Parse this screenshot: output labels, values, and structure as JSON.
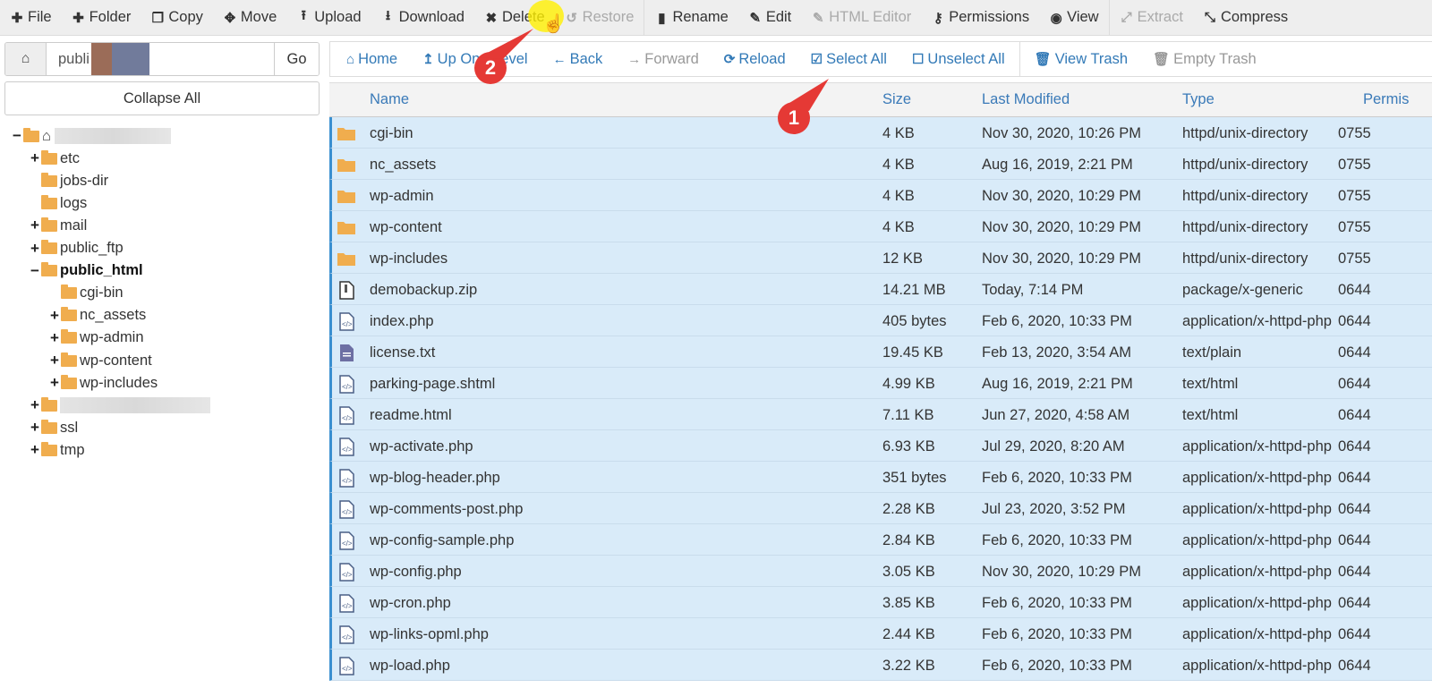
{
  "toolbar": {
    "items": [
      {
        "label": "File",
        "icon": "plus-icon",
        "glyph": "✚",
        "disabled": false
      },
      {
        "label": "Folder",
        "icon": "plus-icon",
        "glyph": "✚",
        "disabled": false
      },
      {
        "label": "Copy",
        "icon": "copy-icon",
        "glyph": "❐",
        "disabled": false
      },
      {
        "label": "Move",
        "icon": "move-icon",
        "glyph": "✥",
        "disabled": false
      },
      {
        "label": "Upload",
        "icon": "upload-icon",
        "glyph": "⭱",
        "disabled": false
      },
      {
        "label": "Download",
        "icon": "download-icon",
        "glyph": "⭳",
        "disabled": false
      },
      {
        "label": "Delete",
        "icon": "delete-icon",
        "glyph": "✖",
        "disabled": false
      },
      {
        "label": "Restore",
        "icon": "restore-icon",
        "glyph": "↺",
        "disabled": true
      },
      {
        "label": "Rename",
        "icon": "file-icon",
        "glyph": "▮",
        "disabled": false
      },
      {
        "label": "Edit",
        "icon": "pencil-icon",
        "glyph": "✎",
        "disabled": false
      },
      {
        "label": "HTML Editor",
        "icon": "edit-square-icon",
        "glyph": "✎",
        "disabled": true
      },
      {
        "label": "Permissions",
        "icon": "key-icon",
        "glyph": "⚷",
        "disabled": false
      },
      {
        "label": "View",
        "icon": "eye-icon",
        "glyph": "◉",
        "disabled": false
      },
      {
        "label": "Extract",
        "icon": "expand-icon",
        "glyph": "⤢",
        "disabled": true
      },
      {
        "label": "Compress",
        "icon": "compress-icon",
        "glyph": "⤡",
        "disabled": false
      }
    ]
  },
  "sidebar": {
    "path_value": "publi",
    "go_label": "Go",
    "collapse_label": "Collapse All",
    "tree": [
      {
        "label": "",
        "toggle": "−",
        "level": 0,
        "home": true,
        "redacted": true
      },
      {
        "label": "etc",
        "toggle": "+",
        "level": 1
      },
      {
        "label": "jobs-dir",
        "toggle": "",
        "level": 1
      },
      {
        "label": "logs",
        "toggle": "",
        "level": 1
      },
      {
        "label": "mail",
        "toggle": "+",
        "level": 1
      },
      {
        "label": "public_ftp",
        "toggle": "+",
        "level": 1
      },
      {
        "label": "public_html",
        "toggle": "−",
        "level": 1,
        "bold": true,
        "open": true
      },
      {
        "label": "cgi-bin",
        "toggle": "",
        "level": 2
      },
      {
        "label": "nc_assets",
        "toggle": "+",
        "level": 2
      },
      {
        "label": "wp-admin",
        "toggle": "+",
        "level": 2
      },
      {
        "label": "wp-content",
        "toggle": "+",
        "level": 2
      },
      {
        "label": "wp-includes",
        "toggle": "+",
        "level": 2
      },
      {
        "label": "",
        "toggle": "+",
        "level": 1,
        "redacted": true
      },
      {
        "label": "ssl",
        "toggle": "+",
        "level": 1
      },
      {
        "label": "tmp",
        "toggle": "+",
        "level": 1
      }
    ]
  },
  "navbar": {
    "items": [
      {
        "label": "Home",
        "icon": "home-icon",
        "glyph": "⌂",
        "disabled": false
      },
      {
        "label": "Up One Level",
        "icon": "level-up-icon",
        "glyph": "↥",
        "disabled": false
      },
      {
        "label": "Back",
        "icon": "arrow-left-icon",
        "glyph": "←",
        "disabled": false
      },
      {
        "label": "Forward",
        "icon": "arrow-right-icon",
        "glyph": "→",
        "disabled": true
      },
      {
        "label": "Reload",
        "icon": "reload-icon",
        "glyph": "⟳",
        "disabled": false
      },
      {
        "label": "Select All",
        "icon": "checkbox-checked-icon",
        "glyph": "☑",
        "disabled": false
      },
      {
        "label": "Unselect All",
        "icon": "checkbox-empty-icon",
        "glyph": "☐",
        "disabled": false
      },
      {
        "label": "View Trash",
        "icon": "trash-icon",
        "glyph": "🗑",
        "disabled": false
      },
      {
        "label": "Empty Trash",
        "icon": "trash-icon",
        "glyph": "🗑",
        "disabled": true
      }
    ]
  },
  "table": {
    "headers": {
      "name": "Name",
      "size": "Size",
      "modified": "Last Modified",
      "type": "Type",
      "perms": "Permis"
    },
    "rows": [
      {
        "icon": "folder",
        "name": "cgi-bin",
        "size": "4 KB",
        "modified": "Nov 30, 2020, 10:26 PM",
        "type": "httpd/unix-directory",
        "perms": "0755"
      },
      {
        "icon": "folder",
        "name": "nc_assets",
        "size": "4 KB",
        "modified": "Aug 16, 2019, 2:21 PM",
        "type": "httpd/unix-directory",
        "perms": "0755"
      },
      {
        "icon": "folder",
        "name": "wp-admin",
        "size": "4 KB",
        "modified": "Nov 30, 2020, 10:29 PM",
        "type": "httpd/unix-directory",
        "perms": "0755"
      },
      {
        "icon": "folder",
        "name": "wp-content",
        "size": "4 KB",
        "modified": "Nov 30, 2020, 10:29 PM",
        "type": "httpd/unix-directory",
        "perms": "0755"
      },
      {
        "icon": "folder",
        "name": "wp-includes",
        "size": "12 KB",
        "modified": "Nov 30, 2020, 10:29 PM",
        "type": "httpd/unix-directory",
        "perms": "0755"
      },
      {
        "icon": "zip",
        "name": "demobackup.zip",
        "size": "14.21 MB",
        "modified": "Today, 7:14 PM",
        "type": "package/x-generic",
        "perms": "0644"
      },
      {
        "icon": "code",
        "name": "index.php",
        "size": "405 bytes",
        "modified": "Feb 6, 2020, 10:33 PM",
        "type": "application/x-httpd-php",
        "perms": "0644"
      },
      {
        "icon": "text",
        "name": "license.txt",
        "size": "19.45 KB",
        "modified": "Feb 13, 2020, 3:54 AM",
        "type": "text/plain",
        "perms": "0644"
      },
      {
        "icon": "code",
        "name": "parking-page.shtml",
        "size": "4.99 KB",
        "modified": "Aug 16, 2019, 2:21 PM",
        "type": "text/html",
        "perms": "0644"
      },
      {
        "icon": "code",
        "name": "readme.html",
        "size": "7.11 KB",
        "modified": "Jun 27, 2020, 4:58 AM",
        "type": "text/html",
        "perms": "0644"
      },
      {
        "icon": "code",
        "name": "wp-activate.php",
        "size": "6.93 KB",
        "modified": "Jul 29, 2020, 8:20 AM",
        "type": "application/x-httpd-php",
        "perms": "0644"
      },
      {
        "icon": "code",
        "name": "wp-blog-header.php",
        "size": "351 bytes",
        "modified": "Feb 6, 2020, 10:33 PM",
        "type": "application/x-httpd-php",
        "perms": "0644"
      },
      {
        "icon": "code",
        "name": "wp-comments-post.php",
        "size": "2.28 KB",
        "modified": "Jul 23, 2020, 3:52 PM",
        "type": "application/x-httpd-php",
        "perms": "0644"
      },
      {
        "icon": "code",
        "name": "wp-config-sample.php",
        "size": "2.84 KB",
        "modified": "Feb 6, 2020, 10:33 PM",
        "type": "application/x-httpd-php",
        "perms": "0644"
      },
      {
        "icon": "code",
        "name": "wp-config.php",
        "size": "3.05 KB",
        "modified": "Nov 30, 2020, 10:29 PM",
        "type": "application/x-httpd-php",
        "perms": "0644"
      },
      {
        "icon": "code",
        "name": "wp-cron.php",
        "size": "3.85 KB",
        "modified": "Feb 6, 2020, 10:33 PM",
        "type": "application/x-httpd-php",
        "perms": "0644"
      },
      {
        "icon": "code",
        "name": "wp-links-opml.php",
        "size": "2.44 KB",
        "modified": "Feb 6, 2020, 10:33 PM",
        "type": "application/x-httpd-php",
        "perms": "0644"
      },
      {
        "icon": "code",
        "name": "wp-load.php",
        "size": "3.22 KB",
        "modified": "Feb 6, 2020, 10:33 PM",
        "type": "application/x-httpd-php",
        "perms": "0644"
      }
    ]
  },
  "annotations": {
    "marker_1": "1",
    "marker_2": "2"
  },
  "colors": {
    "link": "#337ab7",
    "folder": "#f0ad4e",
    "selected_row": "#d9ebf9",
    "marker": "#e53935"
  }
}
